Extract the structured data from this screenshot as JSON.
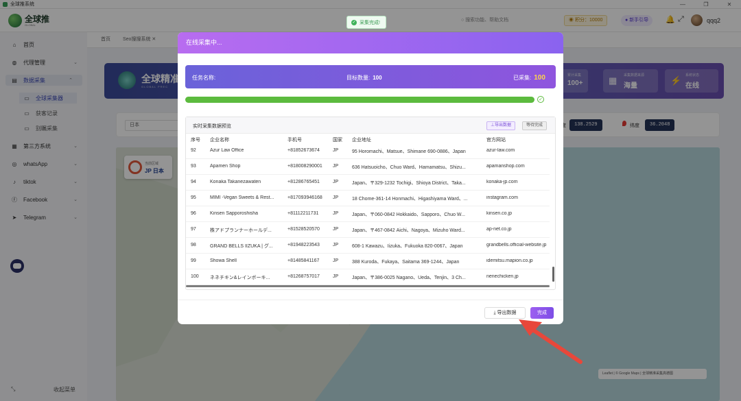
{
  "window": {
    "title": "全球推系统"
  },
  "header": {
    "brand": "全球推",
    "search_text": "搜索功能、帮助文档",
    "credits_label": "积分：",
    "credits_value": "10000",
    "guide_label": "新手引导",
    "username": "qqq2"
  },
  "toast": {
    "text": "采集完成!"
  },
  "sidebar": {
    "items": [
      {
        "label": "首页",
        "icon": "home-icon"
      },
      {
        "label": "代理管理",
        "icon": "globe-icon"
      },
      {
        "label": "数据采集",
        "icon": "database-icon"
      },
      {
        "label": "全球采集器",
        "icon": "map-icon"
      },
      {
        "label": "获客记录",
        "icon": "record-icon"
      },
      {
        "label": "别瞩采集",
        "icon": "collect-icon"
      },
      {
        "label": "第三方系统",
        "icon": "grid-icon"
      },
      {
        "label": "whatsApp",
        "icon": "whatsapp-icon"
      },
      {
        "label": "tiktok",
        "icon": "tiktok-icon"
      },
      {
        "label": "Facebook",
        "icon": "facebook-icon"
      },
      {
        "label": "Telegram",
        "icon": "telegram-icon"
      }
    ],
    "collapse_label": "收起菜单"
  },
  "tabs": [
    "首页",
    "Seo搜搜系统"
  ],
  "hero": {
    "title": "全球精准",
    "subtitle": "GLOBAL PREC",
    "cards": [
      {
        "title": "累计采集",
        "value": "100+"
      },
      {
        "title": "采集数据来源",
        "value": "海量"
      },
      {
        "title": "系统状态",
        "value": "在线"
      }
    ]
  },
  "filter": {
    "country": "日本",
    "lng_label": "经度",
    "lng_value": "138.2529",
    "lat_label": "纬度",
    "lat_value": "36.2048"
  },
  "map": {
    "location_label": "当前区域",
    "location_value": "JP 日本",
    "attribution": "Leaflet | © Google Maps | 全球精准采集高德图"
  },
  "modal": {
    "title": "在线采集中...",
    "task_name_label": "任务名称:",
    "target_label": "目标数量:",
    "target_value": "100",
    "collected_label": "已采集:",
    "collected_value": "100",
    "progress": 1.0,
    "preview_title": "实时采集数据预览",
    "export_all_label": "⊥导出数据",
    "stop_label": "等待完成",
    "columns": [
      "序号",
      "企业名称",
      "手机号",
      "国家",
      "企业地址",
      "官方网站"
    ],
    "rows": [
      [
        "92",
        "Azur Law Office",
        "+81852673674",
        "JP",
        "95 Horomachi、Matsue、Shimane 690-0886、Japan",
        "azur-law.com"
      ],
      [
        "93",
        "Apamen Shop",
        "+818008290001",
        "JP",
        "636 Hatsuoicho、Chuo Ward、Hamamatsu、Shizu...",
        "apamanshop.com"
      ],
      [
        "94",
        "Konaka Takanezawaten",
        "+81286765451",
        "JP",
        "Japan、〒329-1232 Tochigi、Shioya District、Taka...",
        "konaka-jp.com"
      ],
      [
        "95",
        "MIMI -Vegan Sweets & Rest...",
        "+817093946168",
        "JP",
        "18 Chome-361-14 Honmachi、Higashiyama Ward、...",
        "instagram.com"
      ],
      [
        "96",
        "Kinsen Sapporoshisha",
        "+81112211731",
        "JP",
        "Japan、〒060-0842 Hokkaido、Sapporo、Chuo W...",
        "kinsen.co.jp"
      ],
      [
        "97",
        "株アドプランナーホールデ...",
        "+81528520570",
        "JP",
        "Japan、〒467-0842 Aichi、Nagoya、Mizuho Ward...",
        "ap-net.co.jp"
      ],
      [
        "98",
        "GRAND BELLS IIZUKA | グ...",
        "+81948223543",
        "JP",
        "608-1 Kawazu、Iizuka、Fukuoka 820-0067、Japan",
        "grandbells.official-website.jp"
      ],
      [
        "99",
        "Showa Shell",
        "+81485841167",
        "JP",
        "388 Kuroda、Fukaya、Saitama 369-1244、Japan",
        "idemitsu.mapion.co.jp"
      ],
      [
        "100",
        "ネネチキン&レインボーキ...",
        "+81268757017",
        "JP",
        "Japan、〒386-0025 Nagano、Ueda、Tenjin、3 Ch...",
        "nenechicken.jp"
      ]
    ],
    "export_button": "导出数据",
    "done_button": "完成"
  }
}
